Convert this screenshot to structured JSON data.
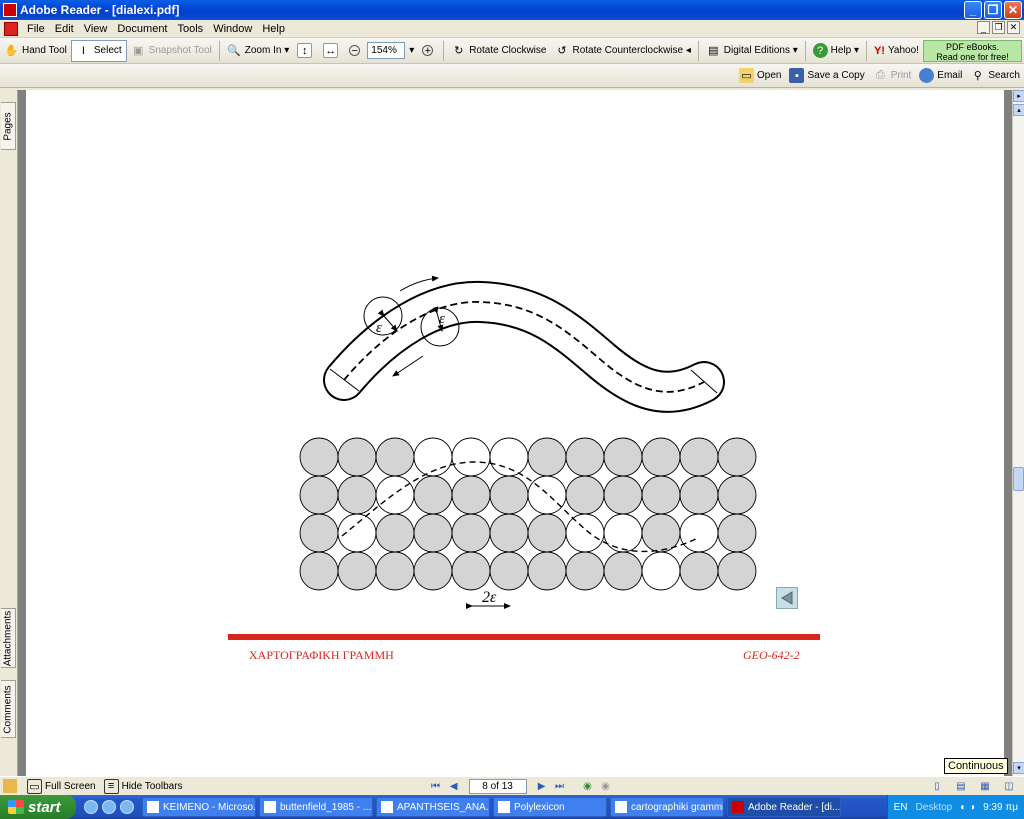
{
  "window": {
    "title": "Adobe Reader - [dialexi.pdf]"
  },
  "menu": [
    "File",
    "Edit",
    "View",
    "Document",
    "Tools",
    "Window",
    "Help"
  ],
  "toolbar": {
    "hand": "Hand Tool",
    "select": "Select",
    "snapshot": "Snapshot Tool",
    "zoom_in": "Zoom In",
    "zoom_value": "154%",
    "rotate_cw": "Rotate Clockwise",
    "rotate_ccw": "Rotate Counterclockwise",
    "digital": "Digital Editions",
    "help": "Help",
    "yahoo": "Yahoo!",
    "ebook_line1": "PDF eBooks.",
    "ebook_line2": "Read one for free!"
  },
  "toolbar2": {
    "open": "Open",
    "save_copy": "Save a Copy",
    "print": "Print",
    "email": "Email",
    "search": "Search"
  },
  "side_tabs": {
    "pages": "Pages",
    "attachments": "Attachments",
    "comments": "Comments"
  },
  "document": {
    "epsilon": "ε",
    "two_epsilon": "2ε",
    "footer_left": "ΧΑΡΤΟΓΡΑΦΙΚΗ ΓΡΑΜΜΗ",
    "footer_right": "GEO-642-2"
  },
  "tooltip": "Continuous",
  "status": {
    "full_screen": "Full Screen",
    "hide_toolbars": "Hide Toolbars",
    "page": "8 of 13"
  },
  "taskbar": {
    "start": "start",
    "tasks": [
      "ΚΕΙΜΕΝΟ - Microso...",
      "buttenfield_1985 - ...",
      "APANTHSEIS_ANA...",
      "Polylexicon",
      "cartographiki grammi",
      "Adobe Reader - [di..."
    ],
    "lang": "EN",
    "desktop": "Desktop",
    "time": "9:39 πμ"
  },
  "grid": {
    "rows": [
      [
        1,
        1,
        1,
        0,
        0,
        0,
        1,
        1,
        1,
        1,
        1,
        1
      ],
      [
        1,
        1,
        0,
        1,
        1,
        1,
        0,
        1,
        1,
        1,
        1,
        1
      ],
      [
        1,
        0,
        1,
        1,
        1,
        1,
        1,
        0,
        0,
        1,
        0,
        1
      ],
      [
        1,
        1,
        1,
        1,
        1,
        1,
        1,
        1,
        1,
        0,
        1,
        1
      ]
    ]
  }
}
